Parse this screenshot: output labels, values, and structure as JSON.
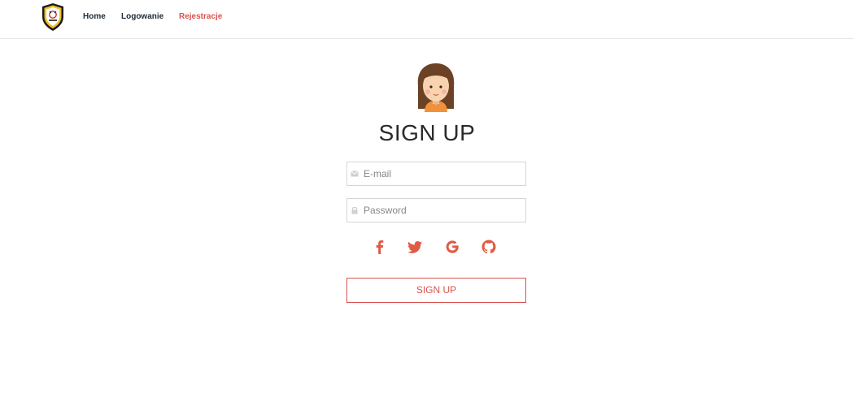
{
  "nav": {
    "links": [
      {
        "label": "Home"
      },
      {
        "label": "Logowanie"
      },
      {
        "label": "Rejestracje",
        "active": true
      }
    ]
  },
  "form": {
    "title": "SIGN UP",
    "email": {
      "value": "",
      "placeholder": "E-mail",
      "icon": "envelope-icon"
    },
    "password": {
      "value": "",
      "placeholder": "Password",
      "icon": "lock-icon"
    },
    "social": [
      "facebook-icon",
      "twitter-icon",
      "google-icon",
      "github-icon"
    ],
    "submit_label": "SIGN UP"
  },
  "colors": {
    "accent": "#d9534f",
    "nav_text": "#1c2b39",
    "border": "#d6d6d6"
  }
}
